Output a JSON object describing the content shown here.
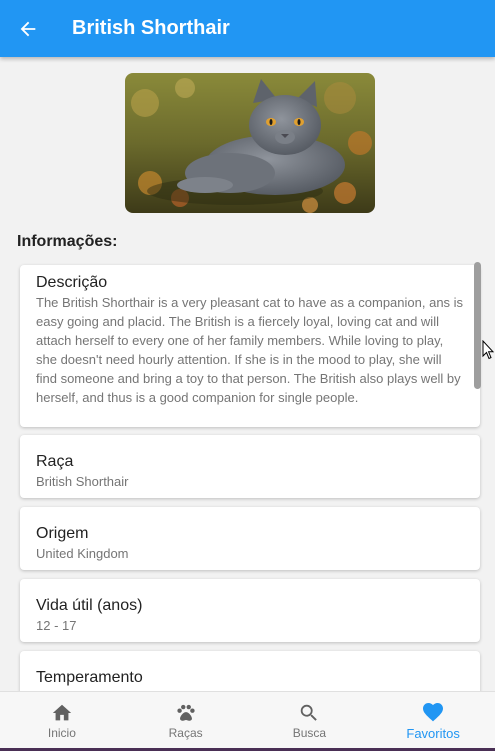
{
  "appbar": {
    "title": "British Shorthair",
    "back_icon": "arrow-left-icon"
  },
  "section": {
    "title": "Informações:"
  },
  "cards": [
    {
      "title": "Descrição",
      "value": "The British Shorthair is a very pleasant cat to have as a companion, ans is easy going and placid. The British is a fiercely loyal, loving cat and will attach herself to every one of her family members. While loving to play, she doesn't need hourly attention. If she is in the mood to play, she will find someone and bring a toy to that person. The British also plays well by herself, and thus is a good companion for single people."
    },
    {
      "title": "Raça",
      "value": "British Shorthair"
    },
    {
      "title": "Origem",
      "value": "United Kingdom"
    },
    {
      "title": "Vida útil (anos)",
      "value": "12 - 17"
    },
    {
      "title": "Temperamento",
      "value": ""
    }
  ],
  "bottom_nav": {
    "items": [
      {
        "label": "Inicio",
        "icon": "home-icon"
      },
      {
        "label": "Raças",
        "icon": "paw-icon"
      },
      {
        "label": "Busca",
        "icon": "search-icon"
      },
      {
        "label": "Favoritos",
        "icon": "heart-icon"
      }
    ],
    "active_index": 3
  },
  "colors": {
    "primary": "#2196f3",
    "inactive": "#757575",
    "background": "#f2f2f2"
  }
}
